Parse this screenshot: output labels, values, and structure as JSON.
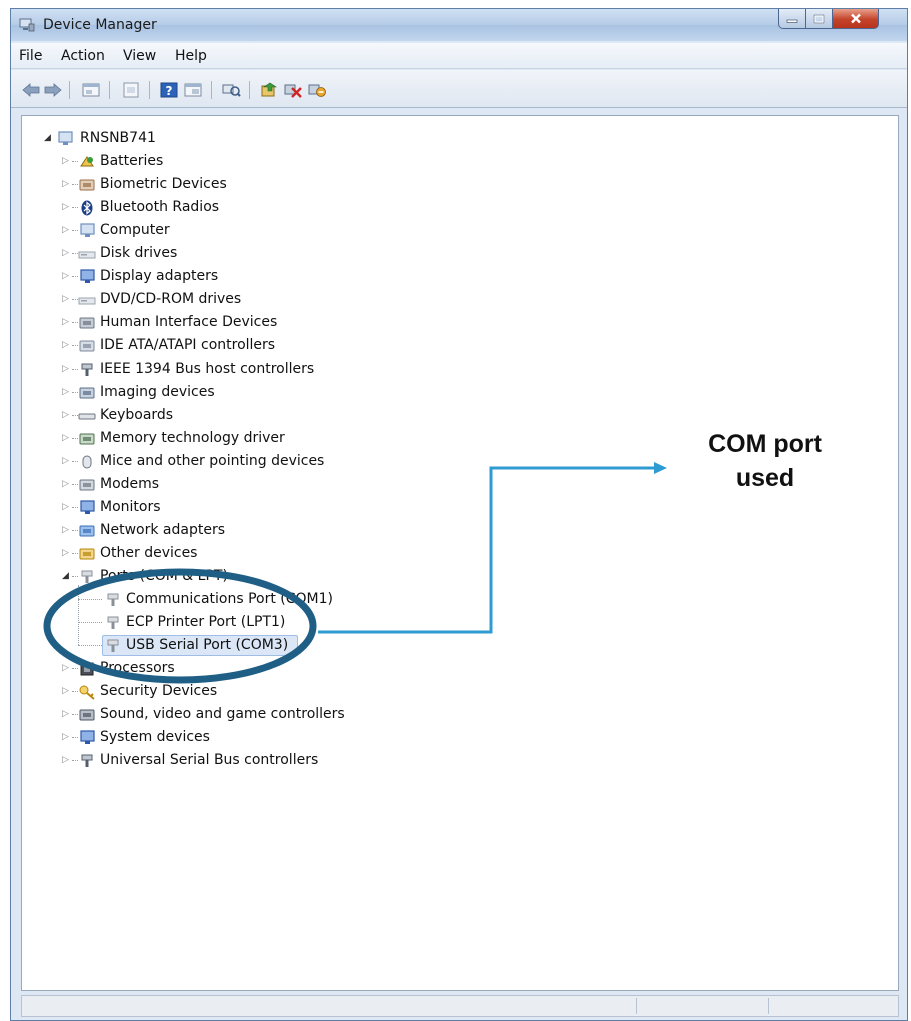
{
  "window": {
    "title": "Device Manager",
    "controls": {
      "minimize": "minimize-icon",
      "maximize": "maximize-icon",
      "close": "close-icon"
    }
  },
  "menu": [
    "File",
    "Action",
    "View",
    "Help"
  ],
  "toolbar": [
    "back-arrow-icon",
    "forward-arrow-icon",
    "properties-icon",
    "update-driver-icon",
    "help-icon",
    "show-hide-icon",
    "scan-hardware-icon",
    "update-driver-software-icon",
    "uninstall-icon",
    "disable-icon"
  ],
  "tree": {
    "root": {
      "label": "RNSNB741",
      "icon": "computer-icon",
      "expanded": true
    },
    "categories": [
      {
        "label": "Batteries",
        "icon": "battery-icon"
      },
      {
        "label": "Biometric Devices",
        "icon": "biometric-icon"
      },
      {
        "label": "Bluetooth Radios",
        "icon": "bluetooth-icon"
      },
      {
        "label": "Computer",
        "icon": "computer-icon"
      },
      {
        "label": "Disk drives",
        "icon": "disk-drive-icon"
      },
      {
        "label": "Display adapters",
        "icon": "display-adapter-icon"
      },
      {
        "label": "DVD/CD-ROM drives",
        "icon": "dvd-drive-icon"
      },
      {
        "label": "Human Interface Devices",
        "icon": "hid-icon"
      },
      {
        "label": "IDE ATA/ATAPI controllers",
        "icon": "ide-controller-icon"
      },
      {
        "label": "IEEE 1394 Bus host controllers",
        "icon": "ieee1394-icon"
      },
      {
        "label": "Imaging devices",
        "icon": "imaging-device-icon"
      },
      {
        "label": "Keyboards",
        "icon": "keyboard-icon"
      },
      {
        "label": "Memory technology driver",
        "icon": "memory-icon"
      },
      {
        "label": "Mice and other pointing devices",
        "icon": "mouse-icon"
      },
      {
        "label": "Modems",
        "icon": "modem-icon"
      },
      {
        "label": "Monitors",
        "icon": "monitor-icon"
      },
      {
        "label": "Network adapters",
        "icon": "network-adapter-icon"
      },
      {
        "label": "Other devices",
        "icon": "other-device-icon"
      },
      {
        "label": "Ports (COM & LPT)",
        "icon": "port-icon",
        "expanded": true,
        "children": [
          {
            "label": "Communications Port (COM1)",
            "icon": "port-icon"
          },
          {
            "label": "ECP Printer Port (LPT1)",
            "icon": "port-icon"
          },
          {
            "label": "USB Serial Port (COM3)",
            "icon": "port-icon",
            "selected": true
          }
        ]
      },
      {
        "label": "Processors",
        "icon": "processor-icon"
      },
      {
        "label": "Security Devices",
        "icon": "security-device-icon"
      },
      {
        "label": "Sound, video and game controllers",
        "icon": "sound-icon"
      },
      {
        "label": "System devices",
        "icon": "system-device-icon"
      },
      {
        "label": "Universal Serial Bus controllers",
        "icon": "usb-icon"
      }
    ]
  },
  "annotation": {
    "line1": "COM port",
    "line2": "used",
    "color": "#2f9bd3",
    "circle_color": "#1f5f86"
  }
}
